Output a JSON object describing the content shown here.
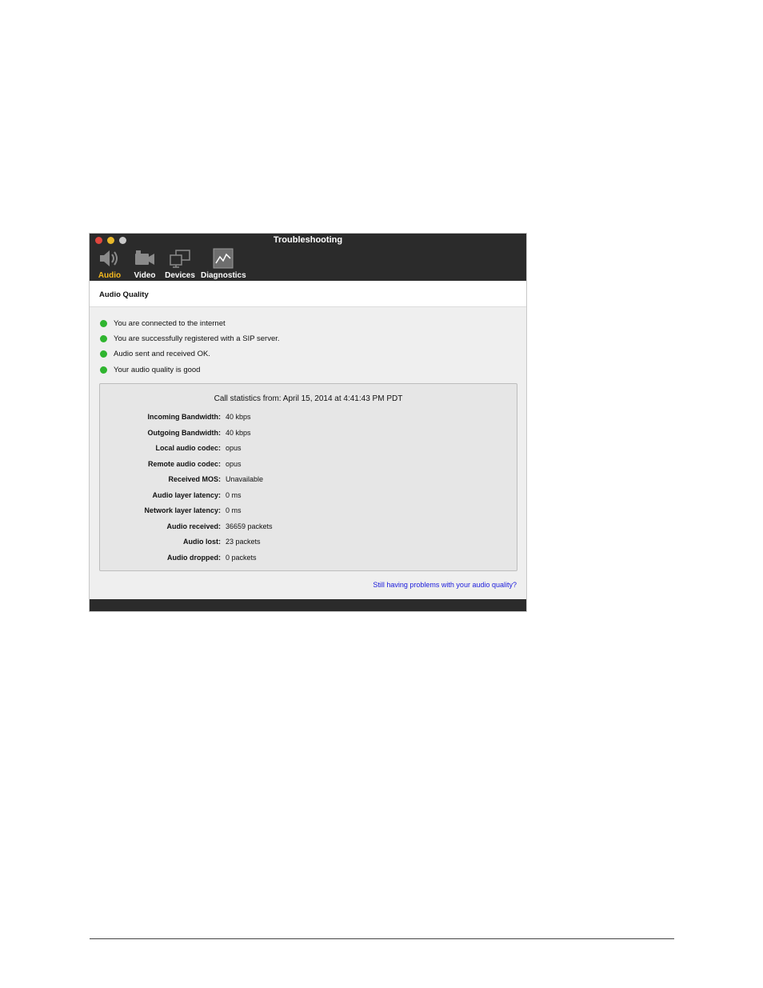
{
  "window": {
    "title": "Troubleshooting"
  },
  "tabs": [
    {
      "label": "Audio",
      "icon": "speaker-icon",
      "active": true
    },
    {
      "label": "Video",
      "icon": "video-camera-icon",
      "active": false
    },
    {
      "label": "Devices",
      "icon": "monitors-icon",
      "active": false
    },
    {
      "label": "Diagnostics",
      "icon": "chart-icon",
      "active": false
    }
  ],
  "section": {
    "title": "Audio Quality"
  },
  "status_items": [
    {
      "text": "You are connected to the internet",
      "status": "ok"
    },
    {
      "text": "You are successfully registered with a SIP server.",
      "status": "ok"
    },
    {
      "text": "Audio sent and received OK.",
      "status": "ok"
    },
    {
      "text": "Your audio quality is good",
      "status": "ok"
    }
  ],
  "stats": {
    "heading": "Call statistics from: April 15, 2014 at 4:41:43 PM PDT",
    "rows": [
      {
        "label": "Incoming Bandwidth:",
        "value": "40 kbps"
      },
      {
        "label": "Outgoing Bandwidth:",
        "value": "40 kbps"
      },
      {
        "label": "Local audio codec:",
        "value": "opus"
      },
      {
        "label": "Remote audio codec:",
        "value": "opus"
      },
      {
        "label": "Received MOS:",
        "value": "Unavailable"
      },
      {
        "label": "Audio layer latency:",
        "value": "0 ms"
      },
      {
        "label": "Network layer latency:",
        "value": "0 ms"
      },
      {
        "label": "Audio received:",
        "value": "36659 packets"
      },
      {
        "label": "Audio lost:",
        "value": "23 packets"
      },
      {
        "label": "Audio dropped:",
        "value": "0 packets"
      }
    ]
  },
  "help_link": "Still having problems with your audio quality?",
  "colors": {
    "active_tab": "#f5b91e",
    "status_ok": "#2fb52f",
    "link": "#1a1adb",
    "titlebar": "#2b2b2b"
  }
}
